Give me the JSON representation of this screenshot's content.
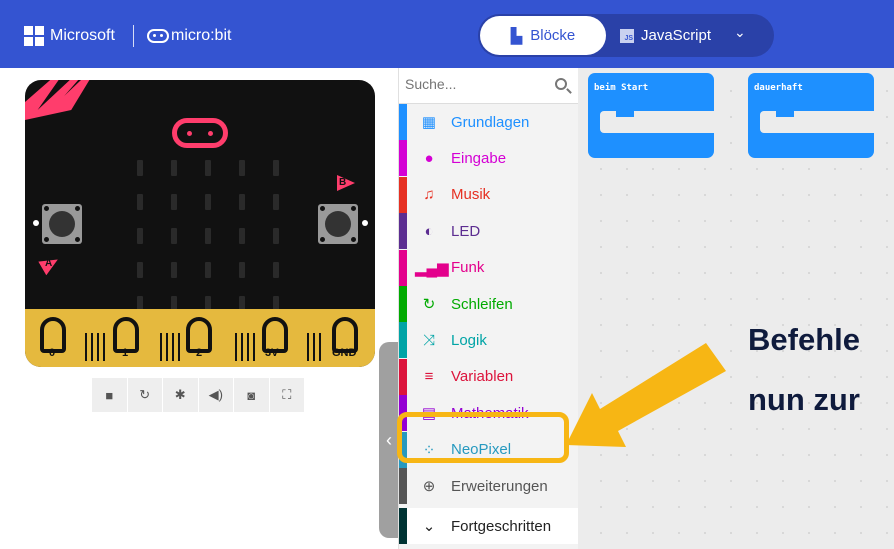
{
  "header": {
    "brand": "Microsoft",
    "product": "micro:bit",
    "tabs": [
      {
        "label": "Blöcke",
        "active": true,
        "icon": "blocks-icon"
      },
      {
        "label": "JavaScript",
        "active": false,
        "icon": "js-icon"
      }
    ],
    "colors": {
      "header_bg": "#3454d1",
      "switch_bg": "#2a41a8"
    }
  },
  "simulator": {
    "pins": [
      "0",
      "1",
      "2",
      "3V",
      "GND"
    ],
    "button_labels": {
      "left": "A",
      "right": "B"
    },
    "toolbar": [
      {
        "name": "stop",
        "glyph": "■"
      },
      {
        "name": "restart",
        "glyph": "↻"
      },
      {
        "name": "debug",
        "glyph": "✱"
      },
      {
        "name": "mute",
        "glyph": "◀)"
      },
      {
        "name": "screenshot",
        "glyph": "◙"
      },
      {
        "name": "fullscreen",
        "glyph": "⛶"
      }
    ]
  },
  "toolbox": {
    "search_placeholder": "Suche...",
    "categories": [
      {
        "label": "Grundlagen",
        "color": "#1e90ff",
        "icon": "grid-icon",
        "glyph": "▦"
      },
      {
        "label": "Eingabe",
        "color": "#d400d4",
        "icon": "circle-icon",
        "glyph": "●"
      },
      {
        "label": "Musik",
        "color": "#e63022",
        "icon": "headphones-icon",
        "glyph": "♫"
      },
      {
        "label": "LED",
        "color": "#5c2d91",
        "icon": "toggle-icon",
        "glyph": "◐"
      },
      {
        "label": "Funk",
        "color": "#e3008c",
        "icon": "signal-icon",
        "glyph": "▂▄▆"
      },
      {
        "label": "Schleifen",
        "color": "#00aa00",
        "icon": "loop-icon",
        "glyph": "↻"
      },
      {
        "label": "Logik",
        "color": "#00a4a6",
        "icon": "shuffle-icon",
        "glyph": "⤨"
      },
      {
        "label": "Variablen",
        "color": "#dc143c",
        "icon": "lines-icon",
        "glyph": "≡"
      },
      {
        "label": "Mathematik",
        "color": "#9400d3",
        "icon": "calculator-icon",
        "glyph": "▤"
      },
      {
        "label": "NeoPixel",
        "color": "#2699bf",
        "icon": "dots-ring-icon",
        "glyph": "⁘"
      },
      {
        "label": "Erweiterungen",
        "color": "#555555",
        "icon": "plus-icon",
        "glyph": "⊕"
      },
      {
        "label": "Fortgeschritten",
        "color": "#003333",
        "icon": "chevron-down-icon",
        "glyph": "⌄"
      }
    ]
  },
  "workspace": {
    "blocks": [
      {
        "title": "beim Start"
      },
      {
        "title": "dauerhaft"
      }
    ]
  },
  "overlay": {
    "line1": "Befehle",
    "line2": "nun zur",
    "accent": "#f7b614"
  }
}
